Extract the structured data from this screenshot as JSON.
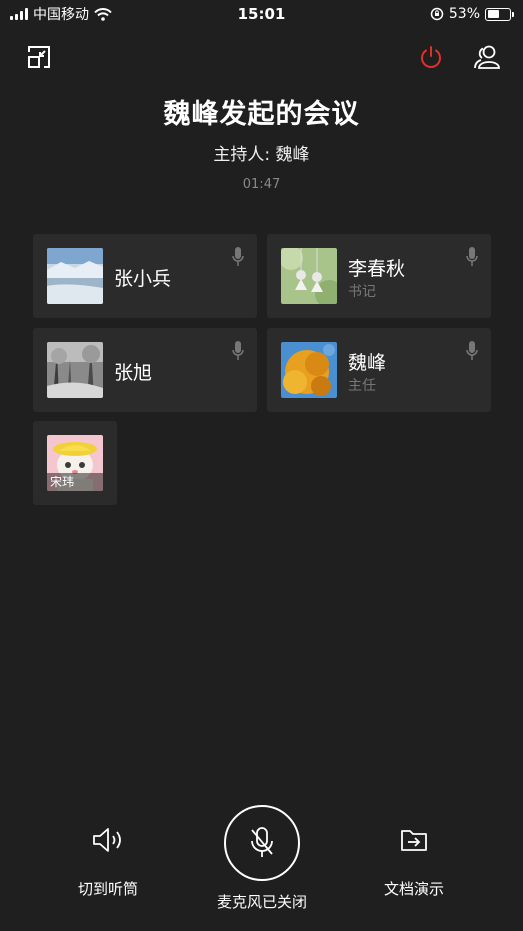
{
  "status_bar": {
    "carrier": "中国移动",
    "time": "15:01",
    "battery": "53%",
    "battery_level": 0.53
  },
  "meeting": {
    "title": "魏峰发起的会议",
    "host": "主持人: 魏峰",
    "elapsed": "01:47"
  },
  "participants": [
    {
      "name": "张小兵",
      "role": ""
    },
    {
      "name": "李春秋",
      "role": "书记"
    },
    {
      "name": "张旭",
      "role": ""
    },
    {
      "name": "魏峰",
      "role": "主任"
    },
    {
      "name": "宋玮",
      "role": ""
    }
  ],
  "controls": {
    "earpiece_label": "切到听筒",
    "mic_label": "麦克风已关闭",
    "doc_label": "文档演示"
  },
  "colors": {
    "background": "#1f1f1f",
    "card": "#2b2b2b",
    "power_red": "#e0302a"
  }
}
